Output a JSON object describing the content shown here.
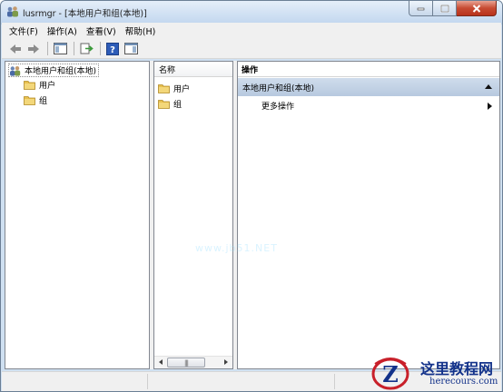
{
  "window": {
    "title": "lusrmgr - [本地用户和组(本地)]"
  },
  "menu": {
    "items": [
      "文件(F)",
      "操作(A)",
      "查看(V)",
      "帮助(H)"
    ]
  },
  "toolbar": {
    "buttons": [
      "back-arrow-icon",
      "forward-arrow-icon",
      "show-hide-console-tree-icon",
      "export-list-icon",
      "help-icon",
      "show-hide-action-pane-icon"
    ]
  },
  "tree": {
    "root": "本地用户和组(本地)",
    "children": [
      "用户",
      "组"
    ]
  },
  "list": {
    "header": "名称",
    "items": [
      "用户",
      "组"
    ],
    "scroll_thumb": "|||"
  },
  "actions": {
    "header": "操作",
    "section": "本地用户和组(本地)",
    "item": "更多操作"
  },
  "watermark": {
    "cn": "这里教程网",
    "en": "herecours.com",
    "faint": "www.jb51.NET"
  },
  "colors": {
    "folder": "#e8c04f",
    "action_section_bg": "#c3d3e8",
    "title_bar": "#c4d8ef",
    "close_button": "#c74a32",
    "watermark_blue": "#13328a"
  }
}
